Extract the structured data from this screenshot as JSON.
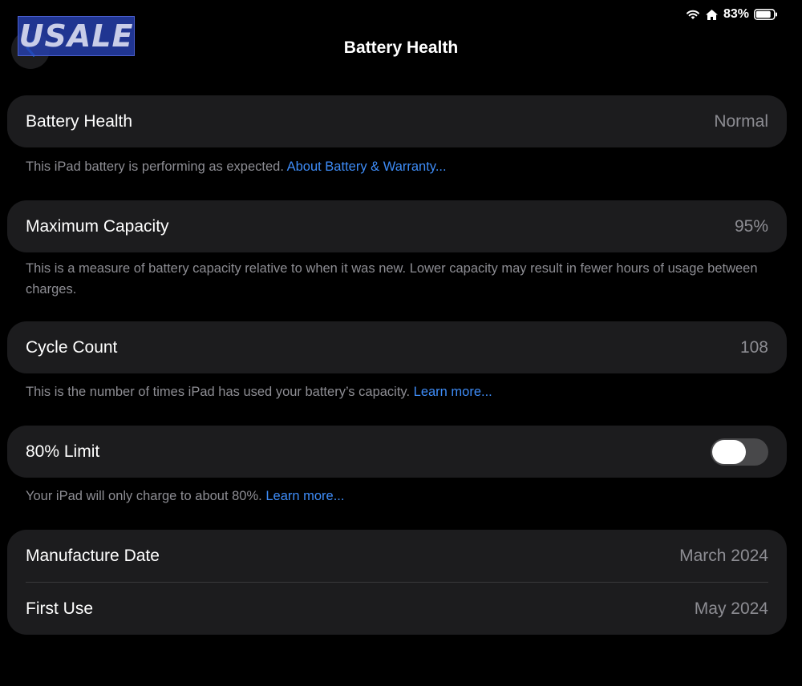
{
  "status_bar": {
    "battery_percent": "83%",
    "icons": [
      "wifi-icon",
      "home-icon",
      "battery-icon"
    ]
  },
  "watermark": {
    "text": "USALE"
  },
  "nav": {
    "title": "Battery Health",
    "back_icon": "chevron-left-icon"
  },
  "battery_health": {
    "label": "Battery Health",
    "value": "Normal",
    "footer_text": "This iPad battery is performing as expected.",
    "footer_link": "About Battery & Warranty..."
  },
  "max_capacity": {
    "label": "Maximum Capacity",
    "value": "95%",
    "footer_text": "This is a measure of battery capacity relative to when it was new. Lower capacity may result in fewer hours of usage between charges."
  },
  "cycle_count": {
    "label": "Cycle Count",
    "value": "108",
    "footer_text": "This is the number of times iPad has used your battery’s capacity.",
    "footer_link": "Learn more..."
  },
  "limit_80": {
    "label": "80% Limit",
    "toggle_on": false,
    "footer_text": "Your iPad will only charge to about 80%.",
    "footer_link": "Learn more..."
  },
  "dates": {
    "manufacture_label": "Manufacture Date",
    "manufacture_value": "March 2024",
    "first_use_label": "First Use",
    "first_use_value": "May 2024"
  },
  "colors": {
    "background": "#000000",
    "card": "#1c1c1e",
    "secondary_text": "#8d8d93",
    "link": "#3e8cf7",
    "toggle_off": "#48484a"
  }
}
